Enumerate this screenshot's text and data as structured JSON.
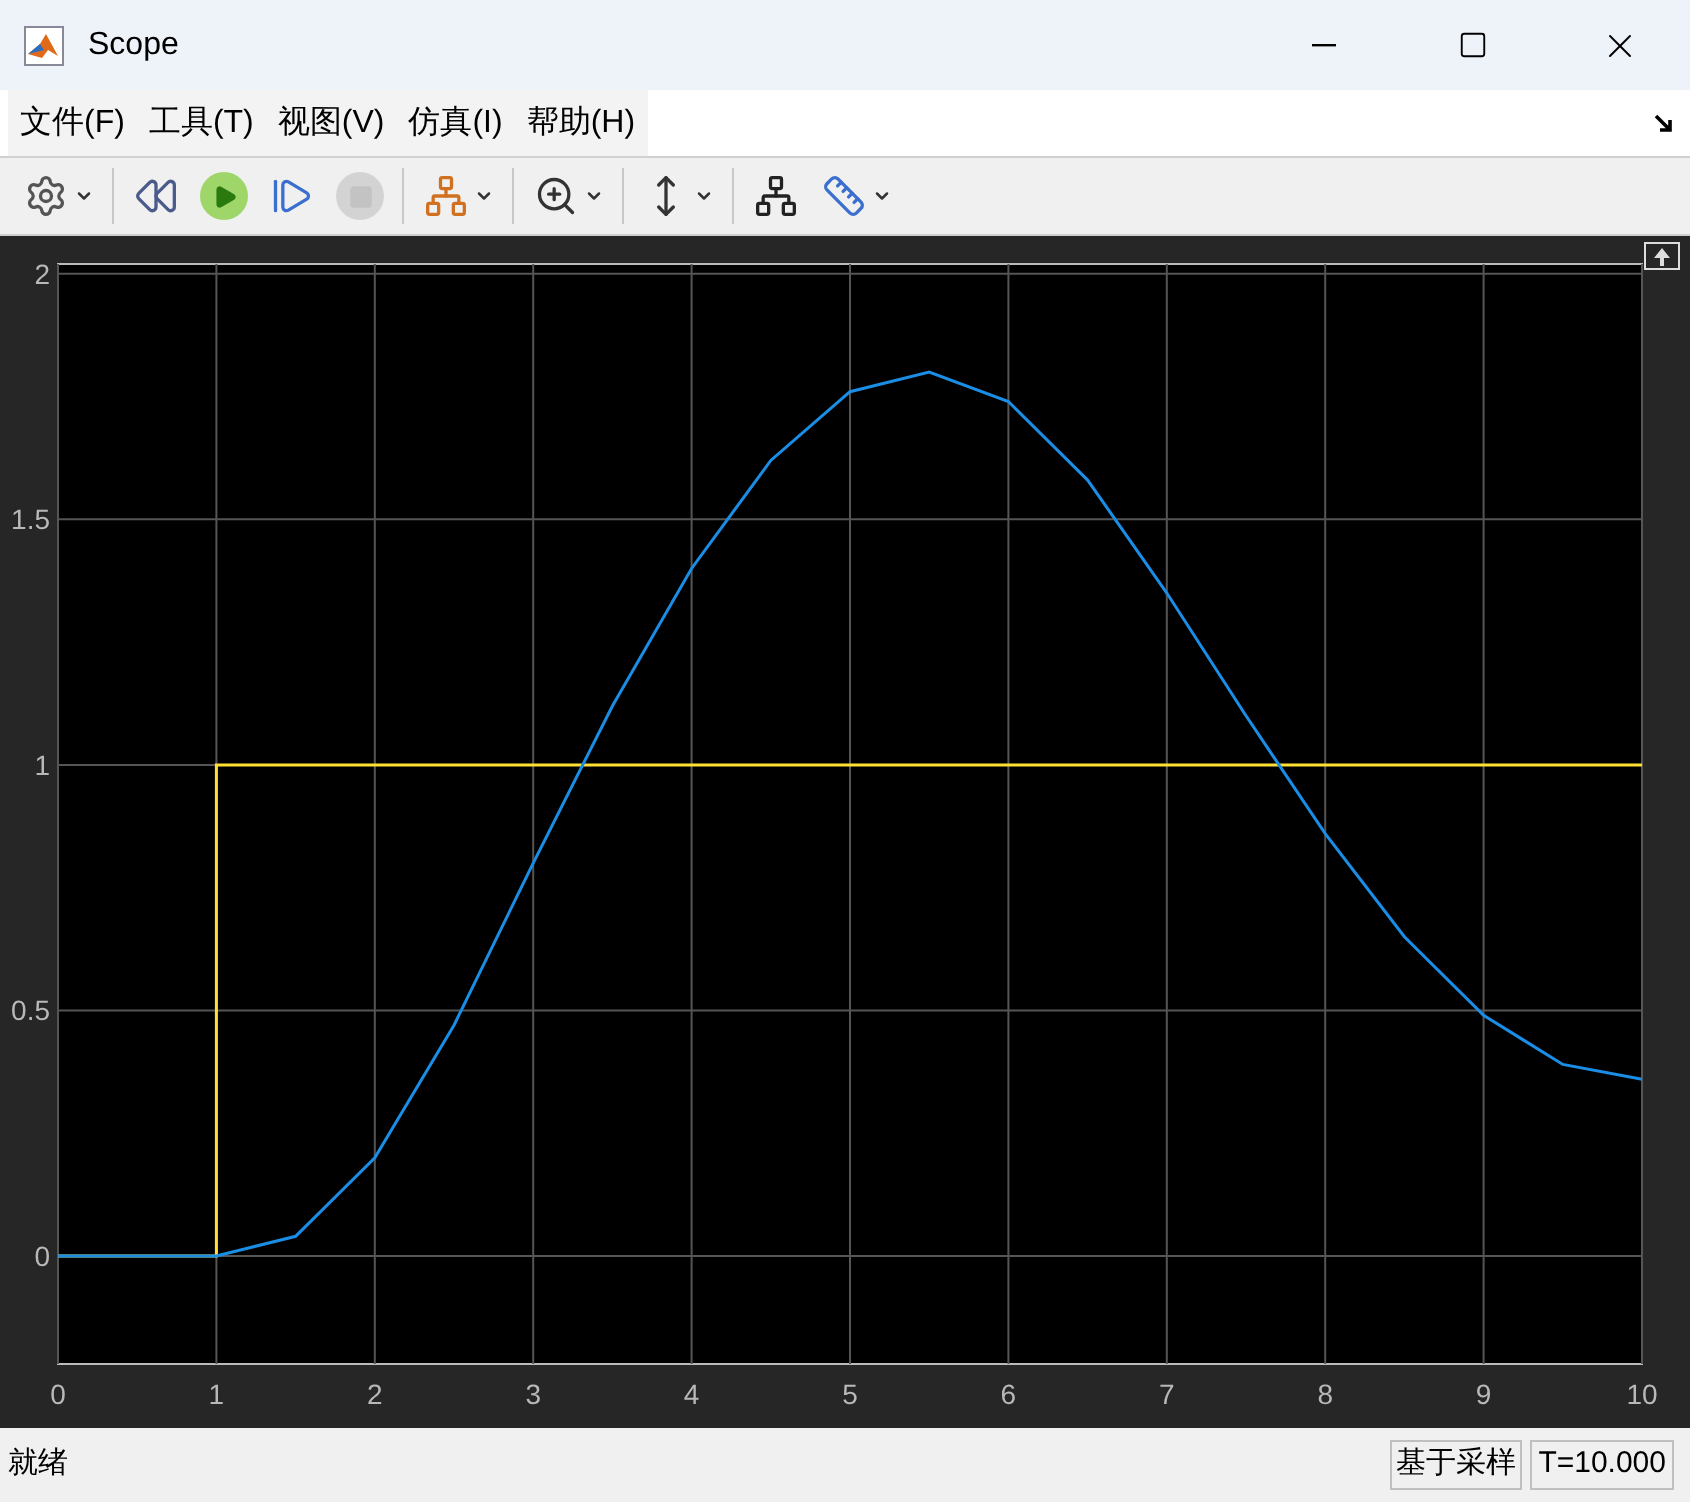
{
  "window": {
    "title": "Scope"
  },
  "menu": [
    {
      "label": "文件(F)"
    },
    {
      "label": "工具(T)"
    },
    {
      "label": "视图(V)"
    },
    {
      "label": "仿真(I)"
    },
    {
      "label": "帮助(H)"
    }
  ],
  "toolbar": [
    {
      "disabled": false
    },
    {
      "disabled": false
    },
    {
      "disabled": false
    },
    {
      "disabled": false
    },
    {
      "disabled": true
    },
    {
      "disabled": false
    },
    {
      "disabled": false
    },
    {
      "disabled": false
    },
    {
      "disabled": false
    },
    {
      "disabled": false
    }
  ],
  "chart_data": {
    "type": "line",
    "x": [
      0,
      0.5,
      1,
      1,
      1.5,
      2,
      2.5,
      3,
      3.5,
      4,
      4.5,
      5,
      5.5,
      6,
      6.5,
      7,
      7.5,
      8,
      8.5,
      9,
      9.5,
      10
    ],
    "series": [
      {
        "color": "#ffe033",
        "values": [
          0,
          0,
          0,
          1,
          1,
          1,
          1,
          1,
          1,
          1,
          1,
          1,
          1,
          1,
          1,
          1,
          1,
          1,
          1,
          1,
          1,
          1
        ]
      },
      {
        "color": "#1a8ee6",
        "values": [
          0,
          0,
          0,
          0,
          0.04,
          0.2,
          0.47,
          0.8,
          1.12,
          1.4,
          1.62,
          1.76,
          1.8,
          1.74,
          1.58,
          1.35,
          1.1,
          0.86,
          0.65,
          0.49,
          0.39,
          0.36
        ]
      }
    ],
    "grid": true,
    "xlim": [
      0,
      10
    ],
    "ylim": [
      -0.22,
      2.02
    ],
    "xticks": [
      0,
      1,
      2,
      3,
      4,
      5,
      6,
      7,
      8,
      9,
      10
    ],
    "yticks": [
      0,
      0.5,
      1,
      1.5,
      2
    ]
  },
  "status_bar": {
    "message": "就绪",
    "mode": "基于采样",
    "time": "T=10.000"
  }
}
